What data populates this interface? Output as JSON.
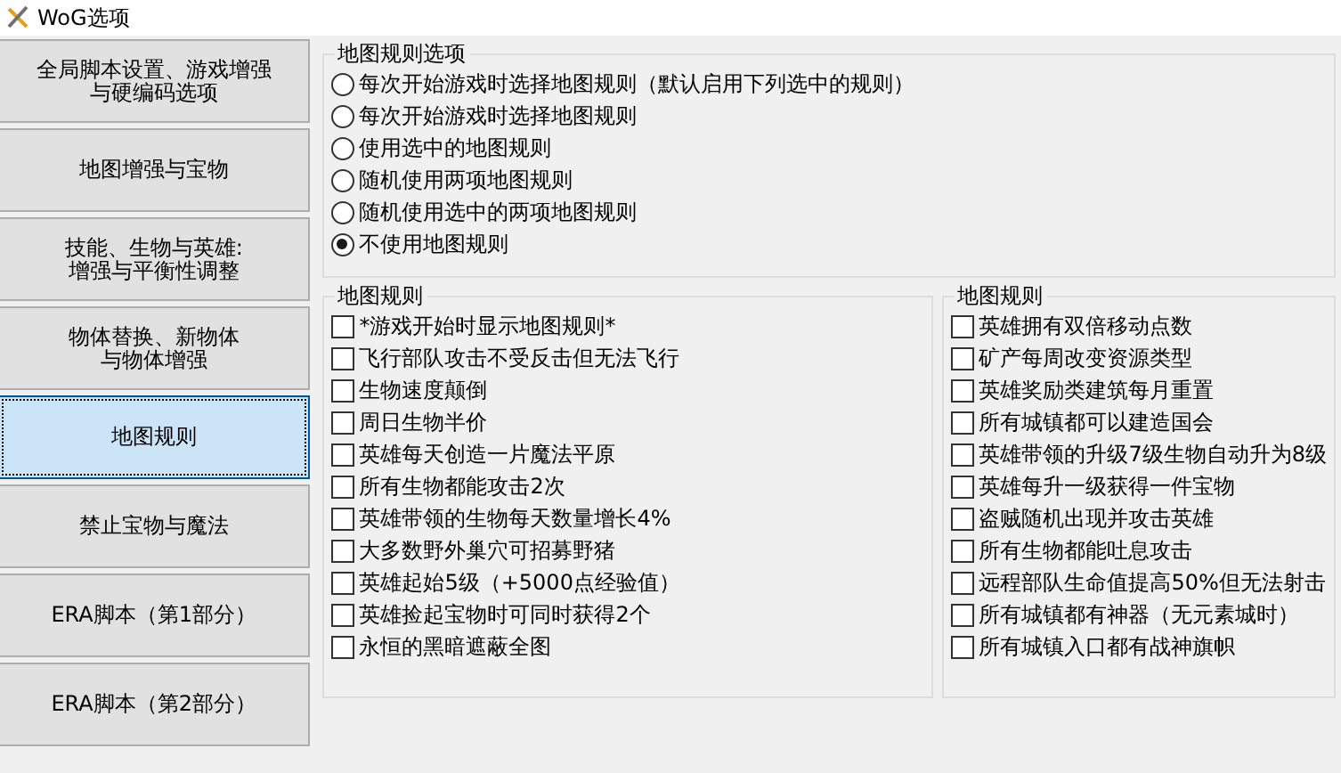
{
  "window": {
    "title": "WoG选项"
  },
  "sidebar": {
    "items": [
      {
        "lines": [
          "全局脚本设置、游戏增强",
          "与硬编码选项"
        ],
        "selected": false
      },
      {
        "lines": [
          "地图增强与宝物"
        ],
        "selected": false
      },
      {
        "lines": [
          "技能、生物与英雄:",
          "增强与平衡性调整"
        ],
        "selected": false
      },
      {
        "lines": [
          "物体替换、新物体",
          "与物体增强"
        ],
        "selected": false
      },
      {
        "lines": [
          "地图规则"
        ],
        "selected": true
      },
      {
        "lines": [
          "禁止宝物与魔法"
        ],
        "selected": false
      },
      {
        "lines": [
          "ERA脚本（第1部分）"
        ],
        "selected": false
      },
      {
        "lines": [
          "ERA脚本（第2部分）"
        ],
        "selected": false
      }
    ]
  },
  "map_rule_options": {
    "title": "地图规则选项",
    "options": [
      {
        "label": "每次开始游戏时选择地图规则（默认启用下列选中的规则）",
        "selected": false
      },
      {
        "label": "每次开始游戏时选择地图规则",
        "selected": false
      },
      {
        "label": "使用选中的地图规则",
        "selected": false
      },
      {
        "label": "随机使用两项地图规则",
        "selected": false
      },
      {
        "label": "随机使用选中的两项地图规则",
        "selected": false
      },
      {
        "label": "不使用地图规则",
        "selected": true
      }
    ]
  },
  "map_rules_left": {
    "title": "地图规则",
    "items": [
      {
        "label": "*游戏开始时显示地图规则*",
        "checked": false
      },
      {
        "label": "飞行部队攻击不受反击但无法飞行",
        "checked": false
      },
      {
        "label": "生物速度颠倒",
        "checked": false
      },
      {
        "label": "周日生物半价",
        "checked": false
      },
      {
        "label": "英雄每天创造一片魔法平原",
        "checked": false
      },
      {
        "label": "所有生物都能攻击2次",
        "checked": false
      },
      {
        "label": "英雄带领的生物每天数量增长4%",
        "checked": false
      },
      {
        "label": "大多数野外巢穴可招募野猪",
        "checked": false
      },
      {
        "label": "英雄起始5级（+5000点经验值）",
        "checked": false
      },
      {
        "label": "英雄捡起宝物时可同时获得2个",
        "checked": false
      },
      {
        "label": "永恒的黑暗遮蔽全图",
        "checked": false
      }
    ]
  },
  "map_rules_right": {
    "title": "地图规则",
    "items": [
      {
        "label": "英雄拥有双倍移动点数",
        "checked": false
      },
      {
        "label": "矿产每周改变资源类型",
        "checked": false
      },
      {
        "label": "英雄奖励类建筑每月重置",
        "checked": false
      },
      {
        "label": "所有城镇都可以建造国会",
        "checked": false
      },
      {
        "label": "英雄带领的升级7级生物自动升为8级",
        "checked": false
      },
      {
        "label": "英雄每升一级获得一件宝物",
        "checked": false
      },
      {
        "label": "盗贼随机出现并攻击英雄",
        "checked": false
      },
      {
        "label": "所有生物都能吐息攻击",
        "checked": false
      },
      {
        "label": "远程部队生命值提高50%但无法射击",
        "checked": false
      },
      {
        "label": "所有城镇都有神器（无元素城时）",
        "checked": false
      },
      {
        "label": "所有城镇入口都有战神旗帜",
        "checked": false
      }
    ]
  }
}
